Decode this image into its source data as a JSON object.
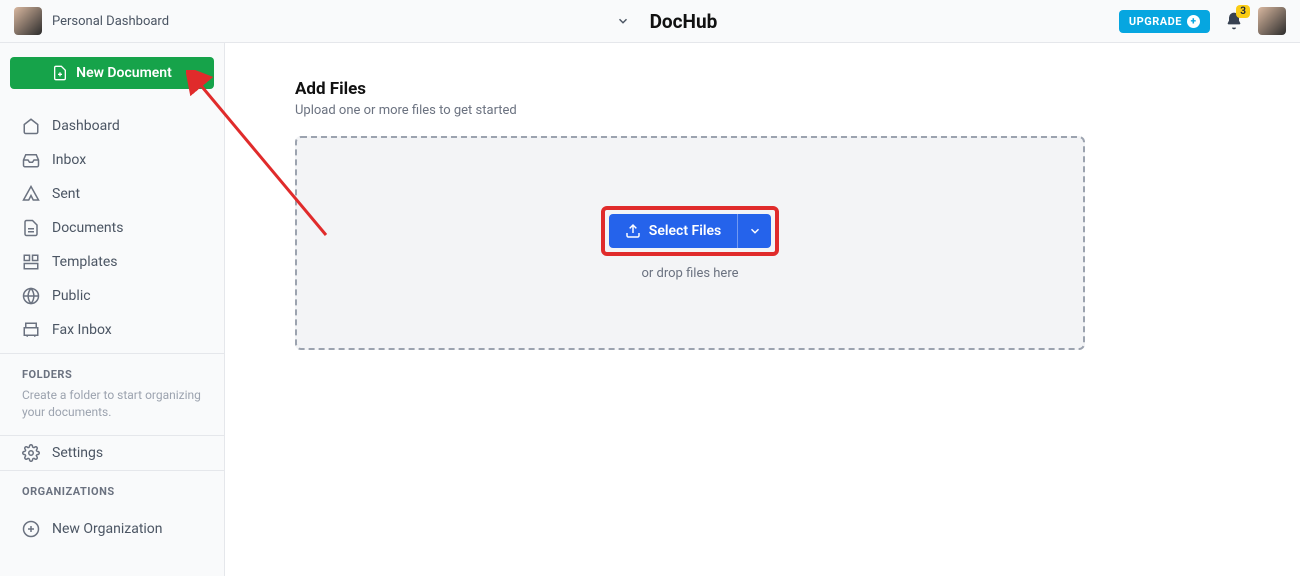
{
  "topbar": {
    "workspace_label": "Personal Dashboard",
    "brand": "DocHub",
    "upgrade_label": "UPGRADE",
    "notification_count": "3"
  },
  "sidebar": {
    "new_document_label": "New Document",
    "nav": [
      {
        "label": "Dashboard"
      },
      {
        "label": "Inbox"
      },
      {
        "label": "Sent"
      },
      {
        "label": "Documents"
      },
      {
        "label": "Templates"
      },
      {
        "label": "Public"
      },
      {
        "label": "Fax Inbox"
      }
    ],
    "folders_title": "FOLDERS",
    "folders_desc": "Create a folder to start organizing your documents.",
    "settings_label": "Settings",
    "orgs_title": "ORGANIZATIONS",
    "new_org_label": "New Organization"
  },
  "main": {
    "add_files_title": "Add Files",
    "add_files_sub": "Upload one or more files to get started",
    "select_files_label": "Select Files",
    "drop_hint": "or drop files here"
  }
}
